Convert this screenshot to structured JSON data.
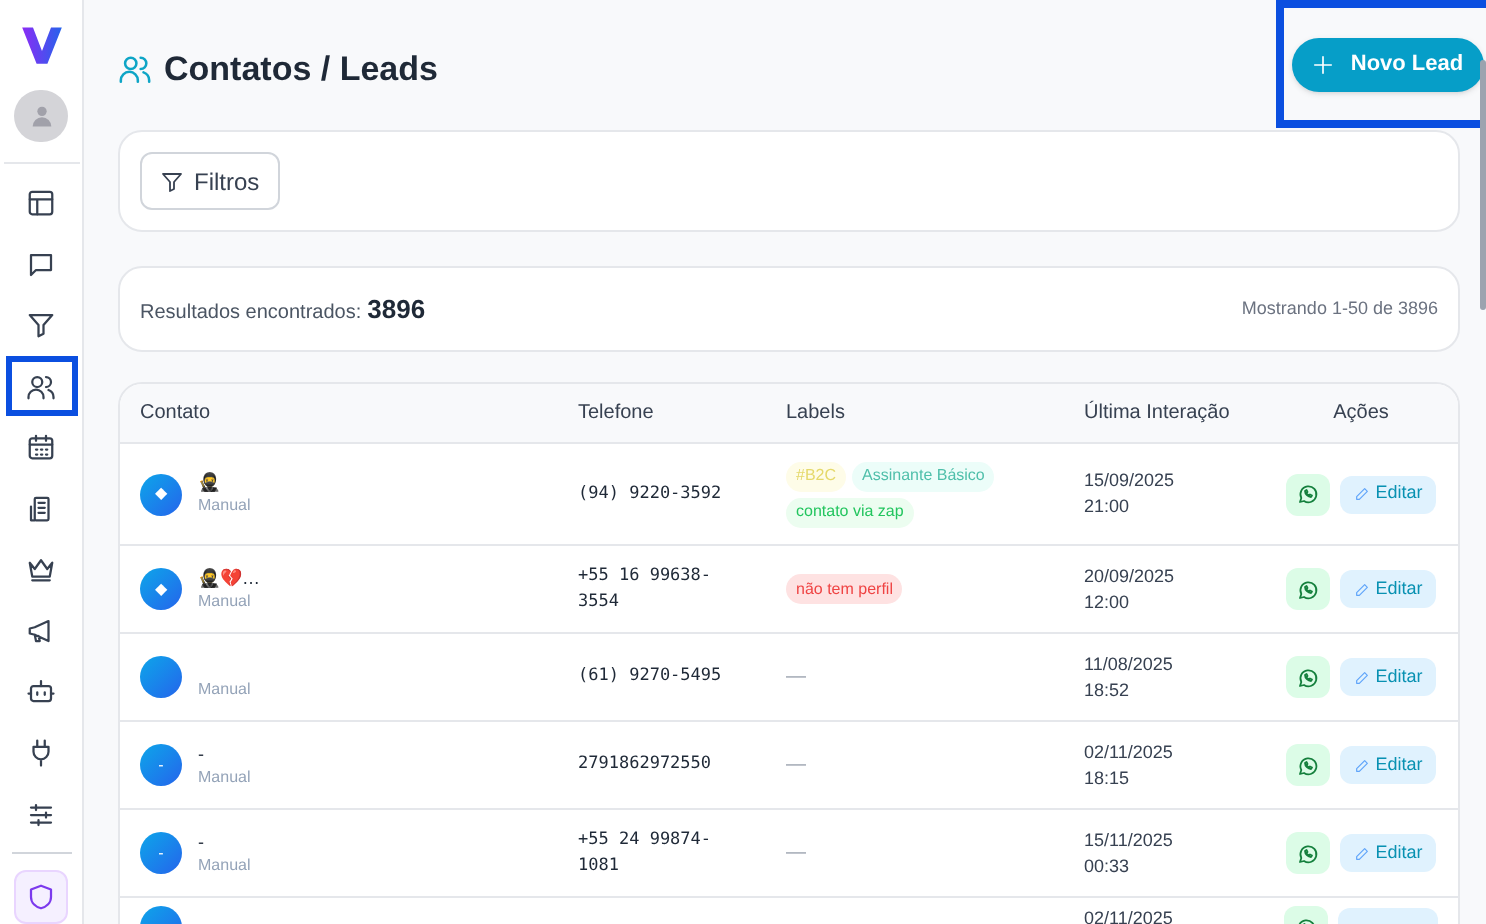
{
  "sidebar": {
    "items": [
      {
        "highlighted": false
      },
      {
        "highlighted": false
      },
      {
        "highlighted": false
      },
      {
        "highlighted": true
      },
      {
        "highlighted": false
      },
      {
        "highlighted": false
      },
      {
        "highlighted": false
      },
      {
        "highlighted": false
      },
      {
        "highlighted": false
      },
      {
        "highlighted": false
      },
      {
        "highlighted": false
      }
    ]
  },
  "header": {
    "title": "Contatos / Leads",
    "new_button": {
      "label": "Novo Lead",
      "highlighted": true
    }
  },
  "filters": {
    "button": "Filtros"
  },
  "results": {
    "label": "Resultados encontrados:",
    "count": "3896",
    "range": "Mostrando 1-50 de 3896"
  },
  "table": {
    "columns": [
      "Contato",
      "Telefone",
      "Labels",
      "Última Interação",
      "Ações"
    ],
    "rows": [
      {
        "initial": "◆",
        "name": "🥷",
        "source": "Manual",
        "phone": "(94) 9220-3592",
        "labels": [
          {
            "text": "#B2C",
            "color": "#fefce8"
          },
          {
            "text": "Assinante Básico",
            "color": "#ecfdf9"
          },
          {
            "text": "contato via zap",
            "color": "#ecfdf0"
          }
        ],
        "last": "15/09/2025\n21:00",
        "edit": "Editar"
      },
      {
        "initial": "◆",
        "name": "🥷💔…",
        "source": "Manual",
        "phone": "+55 16 99638-\n3554",
        "labels": [
          {
            "text": "não tem perfil",
            "color": "#fee2e2"
          }
        ],
        "last": "20/09/2025\n12:00",
        "edit": "Editar"
      },
      {
        "source": "Manual",
        "phone": "(61) 9270-5495",
        "no_labels": "—",
        "last": "11/08/2025\n18:52",
        "edit": "Editar"
      },
      {
        "initial": "-",
        "name": "-",
        "source": "Manual",
        "phone": "2791862972550",
        "no_labels": "—",
        "last": "02/11/2025\n18:15",
        "edit": "Editar"
      },
      {
        "initial": "-",
        "name": "-",
        "source": "Manual",
        "phone": "+55 24 99874-\n1081",
        "no_labels": "—",
        "last": "15/11/2025\n00:33",
        "edit": "Editar"
      },
      {
        "last": "02/11/2025"
      }
    ]
  }
}
